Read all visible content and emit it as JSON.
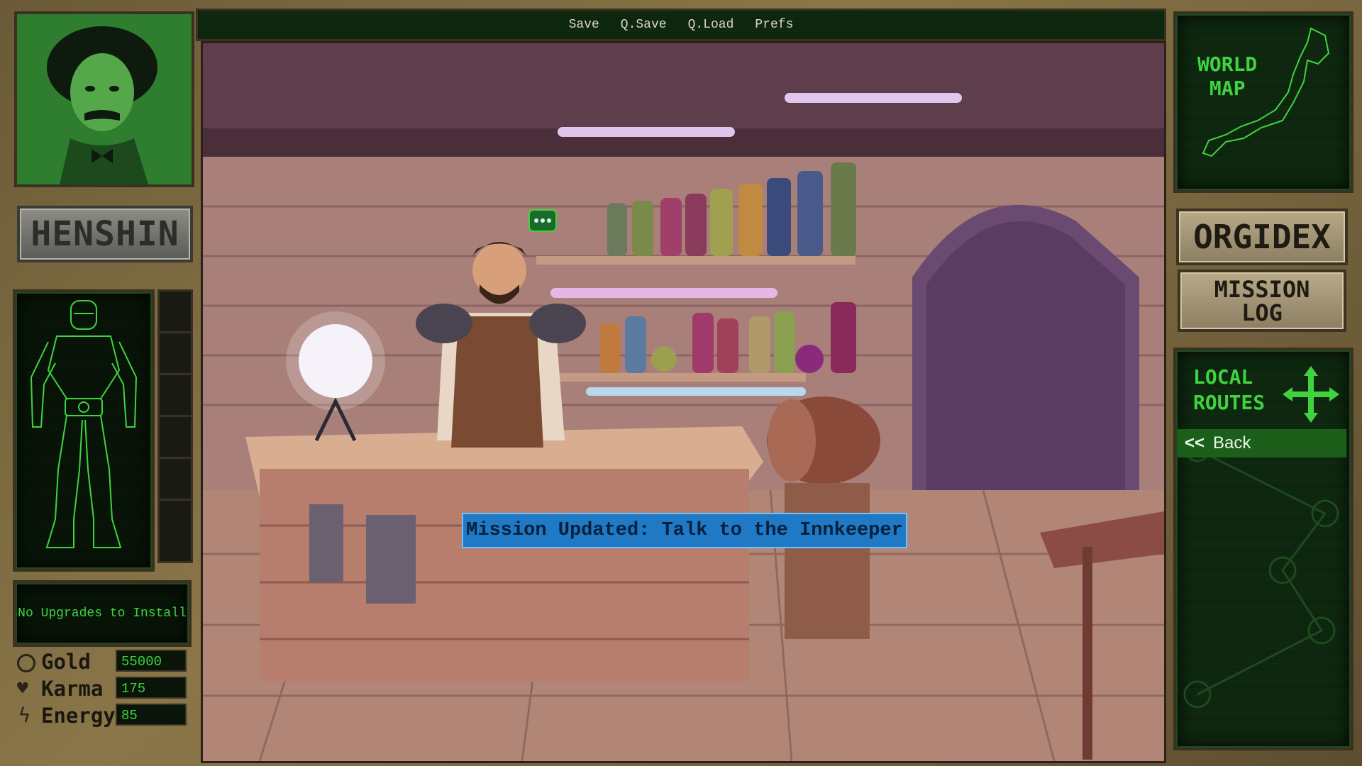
{
  "top_menu": {
    "save": "Save",
    "qsave": "Q.Save",
    "qload": "Q.Load",
    "prefs": "Prefs"
  },
  "left_panel": {
    "henshin_label": "HENSHIN",
    "upgrade_status": "No Upgrades to Install",
    "stats": {
      "gold_label": "Gold",
      "gold_value": "55000",
      "karma_label": "Karma",
      "karma_value": "175",
      "energy_label": "Energy",
      "energy_value": "85"
    }
  },
  "right_panel": {
    "world_map_label_1": "WORLD",
    "world_map_label_2": "MAP",
    "orgidex_label": "ORGIDEX",
    "mission_log_label_1": "MISSION",
    "mission_log_label_2": "LOG",
    "local_routes_label_1": "LOCAL",
    "local_routes_label_2": "ROUTES",
    "back_icon": "<<",
    "back_label": "Back"
  },
  "scene": {
    "notification": "Mission Updated: Talk to the Innkeeper"
  },
  "colors": {
    "crt_green": "#3fd43f",
    "brass": "#8a7648",
    "notification_bg": "#1f79c4"
  }
}
